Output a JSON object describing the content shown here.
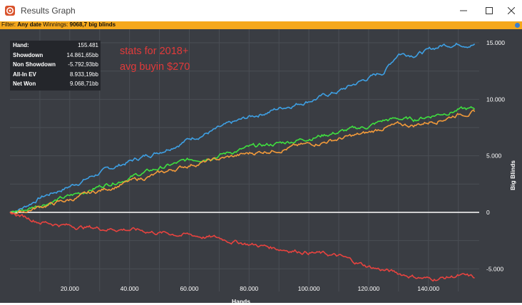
{
  "window": {
    "title": "Results Graph",
    "icon": "app-logo-icon",
    "controls": [
      "minimize-icon",
      "maximize-icon",
      "close-icon"
    ]
  },
  "filter": {
    "label": "Filter:",
    "date": "Any date",
    "winnings_label": "Winnings:",
    "winnings_value": "9068,7 big blinds"
  },
  "stats": [
    {
      "label": "Hand:",
      "value": "155.481"
    },
    {
      "label": "Showdown",
      "value": "14.861,65bb"
    },
    {
      "label": "Non Showdown",
      "value": "-5.792,93bb"
    },
    {
      "label": "All-In EV",
      "value": "8.933,19bb"
    },
    {
      "label": "Net Won",
      "value": "9.068,71bb"
    }
  ],
  "annotation": {
    "line1": "stats for 2018+",
    "line2": "avg buyin $270"
  },
  "colors": {
    "background": "#3a3d43",
    "filter_bar": "#f5a81c",
    "annotation": "#e23a3a"
  },
  "chart_data": {
    "type": "line",
    "xlabel": "Hands",
    "ylabel": "Big Blinds",
    "xlim": [
      0,
      157000
    ],
    "ylim": [
      -7000,
      16200
    ],
    "x_ticks": [
      {
        "value": 20000,
        "label": "20.000"
      },
      {
        "value": 40000,
        "label": "40.000"
      },
      {
        "value": 60000,
        "label": "60.000"
      },
      {
        "value": 80000,
        "label": "80.000"
      },
      {
        "value": 100000,
        "label": "100.000"
      },
      {
        "value": 120000,
        "label": "120.000"
      },
      {
        "value": 140000,
        "label": "140.000"
      }
    ],
    "y_ticks": [
      {
        "value": -5000,
        "label": "-5.000"
      },
      {
        "value": 0,
        "label": "0"
      },
      {
        "value": 5000,
        "label": "5.000"
      },
      {
        "value": 10000,
        "label": "10.000"
      },
      {
        "value": 15000,
        "label": "15.000"
      }
    ],
    "grid": true,
    "series": [
      {
        "color": "#3ea0e4",
        "x": [
          0,
          5000,
          10000,
          20000,
          30000,
          40000,
          50000,
          60000,
          70000,
          80000,
          90000,
          100000,
          110000,
          120000,
          125000,
          130000,
          135000,
          140000,
          145000,
          150000,
          155481
        ],
        "y": [
          0,
          500,
          1300,
          2300,
          3500,
          4500,
          5400,
          6500,
          7400,
          8400,
          9200,
          9900,
          10700,
          11900,
          12400,
          14100,
          14000,
          14300,
          14800,
          14950,
          14900
        ]
      },
      {
        "color": "#3fe03f",
        "x": [
          0,
          5000,
          10000,
          20000,
          30000,
          40000,
          50000,
          60000,
          70000,
          80000,
          90000,
          100000,
          110000,
          120000,
          125000,
          130000,
          135000,
          140000,
          145000,
          150000,
          155481
        ],
        "y": [
          0,
          200,
          700,
          1400,
          2300,
          3100,
          3900,
          4600,
          5100,
          5700,
          6100,
          6600,
          7100,
          7600,
          8100,
          8300,
          8200,
          8500,
          8800,
          9100,
          9100
        ]
      },
      {
        "color": "#f29a3a",
        "x": [
          0,
          5000,
          10000,
          20000,
          30000,
          40000,
          50000,
          60000,
          70000,
          80000,
          90000,
          100000,
          110000,
          120000,
          125000,
          130000,
          135000,
          140000,
          145000,
          150000,
          155481
        ],
        "y": [
          0,
          100,
          500,
          1100,
          1900,
          2700,
          3400,
          4200,
          4700,
          5200,
          5600,
          6000,
          6500,
          7000,
          7500,
          7700,
          7700,
          8000,
          8300,
          8700,
          8900
        ]
      },
      {
        "color": "#e8433f",
        "x": [
          0,
          5000,
          10000,
          20000,
          30000,
          40000,
          50000,
          60000,
          70000,
          80000,
          90000,
          100000,
          110000,
          120000,
          130000,
          140000,
          145000,
          150000,
          155481
        ],
        "y": [
          0,
          -400,
          -800,
          -1200,
          -1400,
          -1500,
          -1800,
          -2000,
          -2300,
          -2800,
          -3200,
          -3500,
          -3900,
          -4800,
          -5400,
          -5900,
          -5800,
          -5600,
          -5800
        ]
      }
    ]
  }
}
